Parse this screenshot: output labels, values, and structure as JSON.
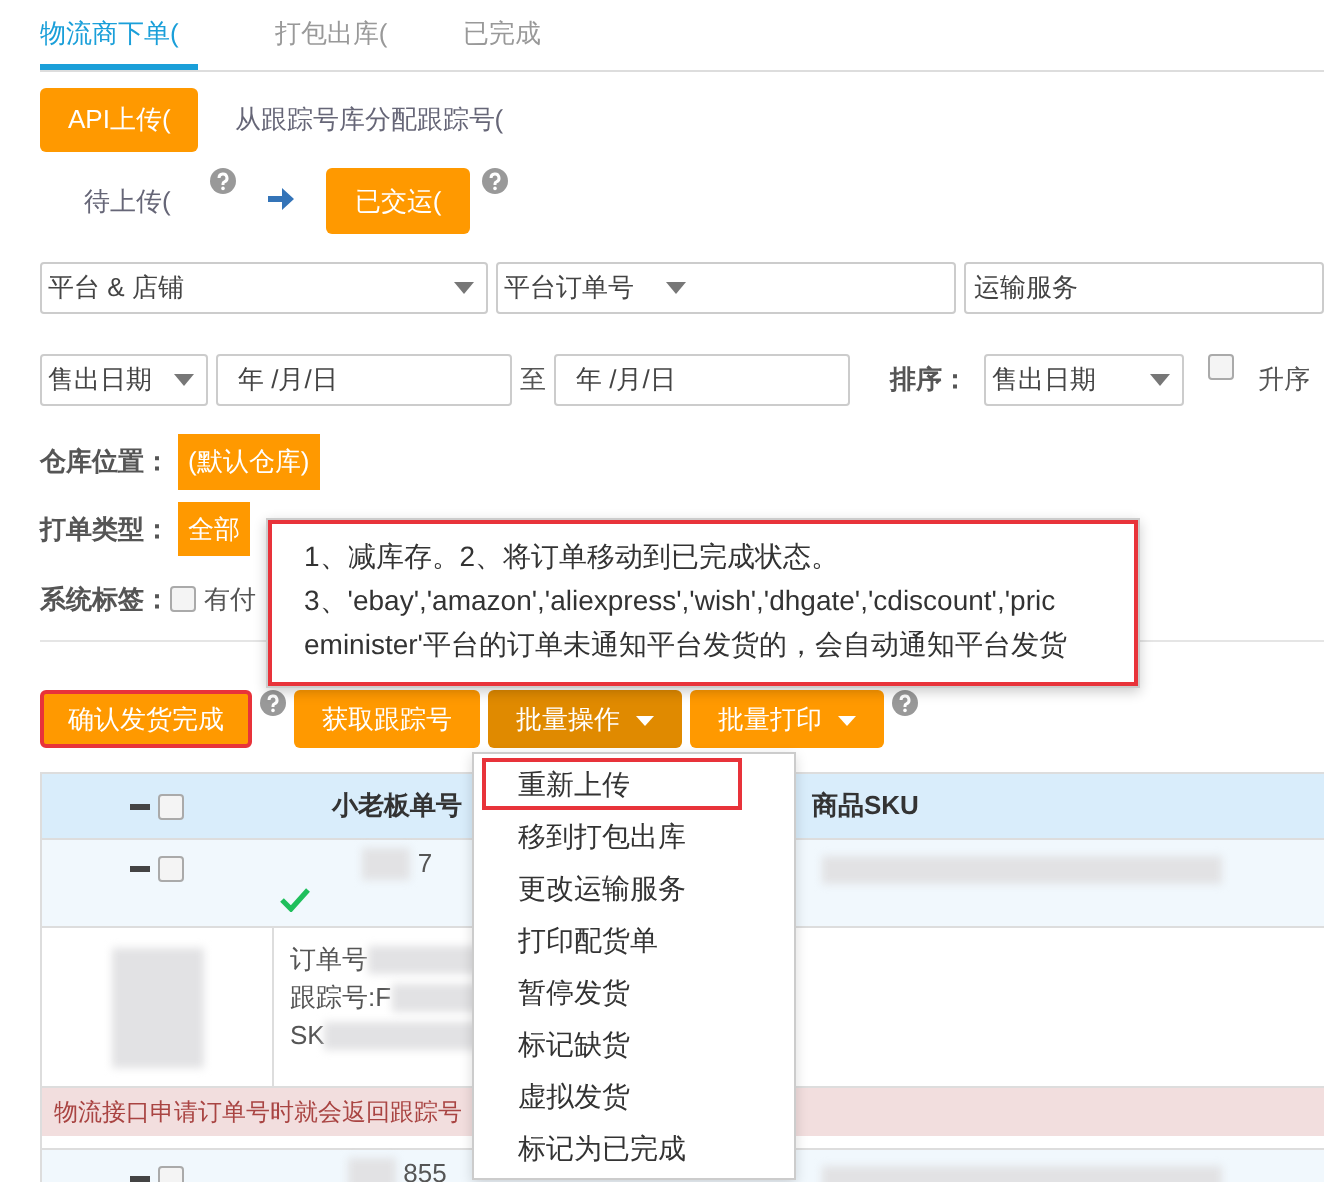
{
  "tabs": [
    {
      "label": "物流商下单(",
      "selected": true
    },
    {
      "label": "打包出库(",
      "selected": false
    },
    {
      "label": "已完成",
      "selected": false
    }
  ],
  "sources": [
    {
      "label": "API上传(",
      "selected": true
    },
    {
      "label": "从跟踪号库分配跟踪号(",
      "selected": false
    }
  ],
  "stages": [
    {
      "label": "待上传(",
      "selected": false
    },
    {
      "label": "已交运(",
      "selected": true
    }
  ],
  "filters": {
    "platform": "平台 & 店铺",
    "order_field": "平台订单号",
    "shipping": "运输服务",
    "date_type": "售出日期",
    "date_from": "年 /月/日",
    "to": "至",
    "date_to": "年 /月/日",
    "sort_label": "排序：",
    "sort": "售出日期",
    "asc_label": "升序",
    "asc_checked": false
  },
  "warehouse": {
    "label": "仓库位置：",
    "tags": [
      {
        "label": "(默认仓库)",
        "selected": true
      }
    ]
  },
  "print_type": {
    "label": "打单类型：",
    "tags": [
      {
        "label": "全部",
        "selected": true
      }
    ]
  },
  "system_tags": {
    "label": "系统标签：",
    "options": [
      {
        "label": "有付",
        "checked": false
      }
    ]
  },
  "tooltip": {
    "highlighted": true,
    "lines": [
      "1、减库存。2、将订单移动到已完成状态。",
      "3、'ebay','amazon','aliexpress','wish','dhgate','cdiscount','pric",
      "eminister'平台的订单未通知平台发货的，会自动通知平台发货"
    ]
  },
  "actions": [
    {
      "label": "确认发货完成",
      "kind": "button",
      "highlighted": true,
      "help": true
    },
    {
      "label": "获取跟踪号",
      "kind": "button",
      "highlighted": false,
      "help": false
    },
    {
      "label": "批量操作",
      "kind": "dropdown",
      "highlighted": false,
      "help": false,
      "expanded": true
    },
    {
      "label": "批量打印",
      "kind": "dropdown",
      "highlighted": false,
      "help": true,
      "expanded": false
    }
  ],
  "menu": [
    {
      "label": "重新上传",
      "highlighted": true
    },
    {
      "label": "移到打包出库",
      "highlighted": false
    },
    {
      "label": "更改运输服务",
      "highlighted": false
    },
    {
      "label": "打印配货单",
      "highlighted": false
    },
    {
      "label": "暂停发货",
      "highlighted": false
    },
    {
      "label": "标记缺货",
      "highlighted": false
    },
    {
      "label": "虚拟发货",
      "highlighted": false
    },
    {
      "label": "标记为已完成",
      "highlighted": false
    }
  ],
  "table": {
    "all_checked": false,
    "columns": [
      "小老板单号",
      "商品SKU"
    ],
    "orders": [
      {
        "number": "7",
        "checked": false,
        "shipped": true,
        "details": [
          "订单号",
          "跟踪号:F",
          "SK"
        ],
        "note": "物流接口申请订单号时就会返回跟踪号"
      },
      {
        "number": "855",
        "checked": false
      }
    ]
  }
}
